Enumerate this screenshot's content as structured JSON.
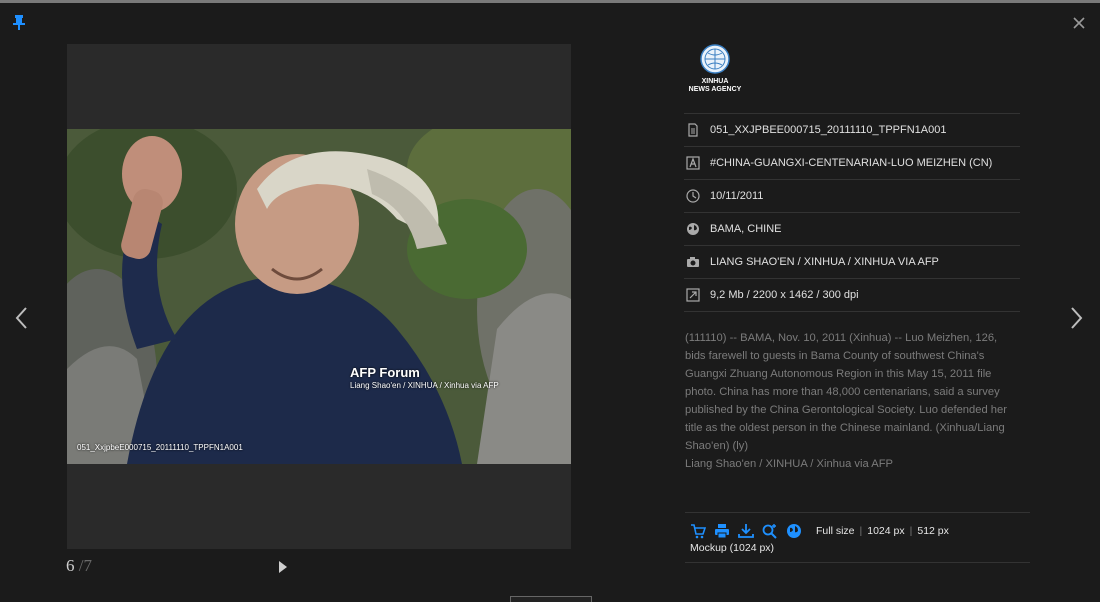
{
  "viewer": {
    "current_index": "6",
    "total": "/7",
    "watermark_title": "AFP Forum",
    "watermark_credit": "Liang Shao'en / XINHUA / Xinhua via AFP",
    "image_id_overlay": "051_XxjpbeE000715_20111110_TPPFN1A001"
  },
  "logo": {
    "line1": "XINHUA",
    "line2": "NEWS AGENCY"
  },
  "metadata": [
    {
      "icon": "document-icon",
      "value": "051_XXJPBEE000715_20111110_TPPFN1A001"
    },
    {
      "icon": "keyword-icon",
      "value": "#CHINA-GUANGXI-CENTENARIAN-LUO MEIZHEN (CN)"
    },
    {
      "icon": "clock-icon",
      "value": "10/11/2011"
    },
    {
      "icon": "globe-icon",
      "value": "BAMA, CHINE"
    },
    {
      "icon": "camera-icon",
      "value": "LIANG SHAO'EN / XINHUA / XINHUA VIA AFP"
    },
    {
      "icon": "resize-icon",
      "value": "9,2 Mb / 2200 x 1462 / 300 dpi"
    }
  ],
  "caption": {
    "text": "(111110) -- BAMA, Nov. 10, 2011 (Xinhua) -- Luo Meizhen, 126, bids farewell to guests in Bama County of southwest China's Guangxi Zhuang Autonomous Region in this May 15, 2011 file photo. China has more than 48,000 centenarians, said a survey published by the China Gerontological Society. Luo defended her title as the oldest person in the Chinese mainland. (Xinhua/Liang Shao'en) (ly)",
    "credit": "Liang Shao'en / XINHUA / Xinhua via AFP"
  },
  "actions": {
    "icons": [
      "cart-icon",
      "print-icon",
      "download-icon",
      "zoom-in-icon",
      "globe-icon"
    ],
    "full_size": "Full size",
    "size_1024": "1024 px",
    "size_512": "512 px",
    "mockup": "Mockup (1024 px)",
    "accent_color": "#1e90ff"
  }
}
